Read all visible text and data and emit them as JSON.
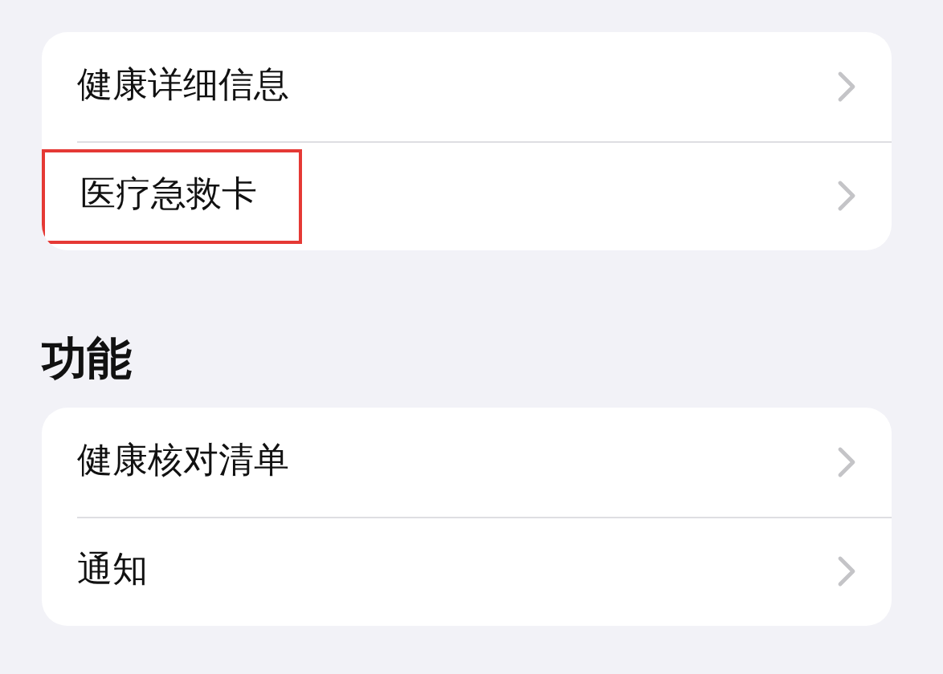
{
  "sections": [
    {
      "items": [
        {
          "label": "健康详细信息",
          "highlighted": false
        },
        {
          "label": "医疗急救卡",
          "highlighted": true
        }
      ]
    },
    {
      "title": "功能",
      "items": [
        {
          "label": "健康核对清单",
          "highlighted": false
        },
        {
          "label": "通知",
          "highlighted": false
        }
      ]
    }
  ]
}
